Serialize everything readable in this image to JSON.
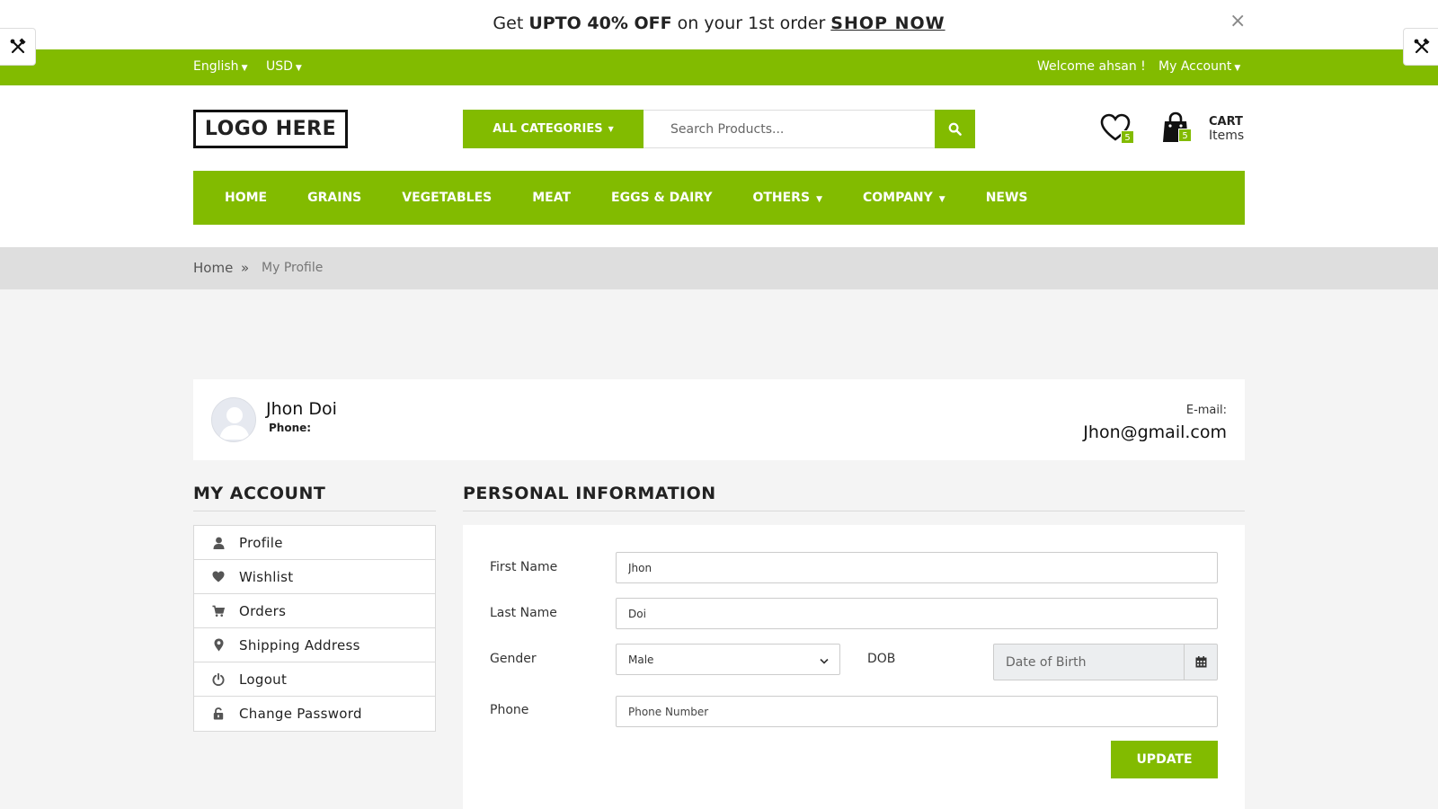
{
  "promo": {
    "prefix": "Get ",
    "highlight": "UPTO 40% OFF",
    "middle": " on your 1st order ",
    "cta": "SHOP NOW",
    "close": "×"
  },
  "topbar": {
    "language": "English",
    "currency": "USD",
    "welcome": "Welcome ahsan !",
    "account": "My Account"
  },
  "header": {
    "logo": "LOGO HERE",
    "categories": "ALL CATEGORIES",
    "search_placeholder": "Search Products...",
    "wishlist_count": "5",
    "cart_count": "5",
    "cart_title": "CART",
    "cart_sub": "Items"
  },
  "nav": {
    "items": [
      {
        "label": "HOME"
      },
      {
        "label": "GRAINS"
      },
      {
        "label": "VEGETABLES"
      },
      {
        "label": "MEAT"
      },
      {
        "label": "EGGS & DAIRY"
      },
      {
        "label": "OTHERS",
        "dropdown": true
      },
      {
        "label": "COMPANY",
        "dropdown": true
      },
      {
        "label": "NEWS"
      }
    ]
  },
  "breadcrumb": {
    "home": "Home",
    "separator": "»",
    "current": "My Profile"
  },
  "profile": {
    "name": "Jhon Doi",
    "phone_label": "Phone:",
    "email_label": "E-mail:",
    "email": "Jhon@gmail.com"
  },
  "account_menu": {
    "title": "MY ACCOUNT",
    "items": [
      {
        "label": "Profile",
        "icon": "user-icon"
      },
      {
        "label": "Wishlist",
        "icon": "heart-icon"
      },
      {
        "label": "Orders",
        "icon": "cart-icon"
      },
      {
        "label": "Shipping Address",
        "icon": "map-pin-icon"
      },
      {
        "label": "Logout",
        "icon": "power-icon"
      },
      {
        "label": "Change Password",
        "icon": "unlock-icon"
      }
    ]
  },
  "form": {
    "title": "PERSONAL INFORMATION",
    "first_name_label": "First Name",
    "first_name_value": "Jhon",
    "last_name_label": "Last Name",
    "last_name_value": "Doi",
    "gender_label": "Gender",
    "gender_value": "Male",
    "dob_label": "DOB",
    "dob_placeholder": "Date of Birth",
    "phone_label": "Phone",
    "phone_placeholder": "Phone Number",
    "update": "UPDATE"
  },
  "colors": {
    "accent": "#82bb00"
  }
}
